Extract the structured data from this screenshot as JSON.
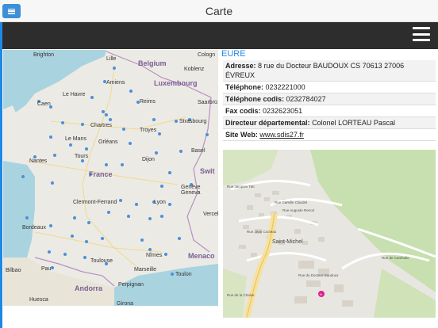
{
  "header": {
    "title": "Carte"
  },
  "departement": {
    "name": "EURE",
    "fields": [
      {
        "label": "Adresse:",
        "value": "8 rue du Docteur BAUDOUX CS 70613 27006 ÉVREUX"
      },
      {
        "label": "Téléphone:",
        "value": "0232221000"
      },
      {
        "label": "Téléphone codis:",
        "value": "0232784027"
      },
      {
        "label": "Fax codis:",
        "value": "0232623051"
      },
      {
        "label": "Directeur départemental:",
        "value": "Colonel LORTEAU Pascal"
      }
    ],
    "web": {
      "label": "Site Web:",
      "value": "www.sdis27.fr"
    }
  },
  "france_map": {
    "countries": [
      "Belgium",
      "Luxembourg",
      "France",
      "Switz",
      "Andorra",
      "Monaco"
    ],
    "cities": [
      "Brighton",
      "Lille",
      "Cologn",
      "Koblenz",
      "Amiens",
      "Le Havre",
      "Caen",
      "Reims",
      "Saarbrü",
      "Chartres",
      "Strasbourg",
      "Le Mans",
      "Orléans",
      "Troyes",
      "Nantes",
      "Tours",
      "Dijon",
      "Basel",
      "Genève Geneva",
      "Clermont-Ferrand",
      "Lyon",
      "Vercel",
      "Bordeaux",
      "Toulouse",
      "Nîmes",
      "Marseille",
      "Toulon",
      "Pau",
      "Bilbao",
      "Perpignan",
      "Huesca",
      "Girona"
    ]
  },
  "local_map": {
    "labels": [
      "Saint-Michel",
      "Rue Jacques Tati",
      "Rue Camille Claudel",
      "Rue Auguste Renoir",
      "Rue de la Chaise",
      "Rue du Docteur Baudoux",
      "Rue Jean Cocteau",
      "Rue de Cambolle"
    ]
  }
}
